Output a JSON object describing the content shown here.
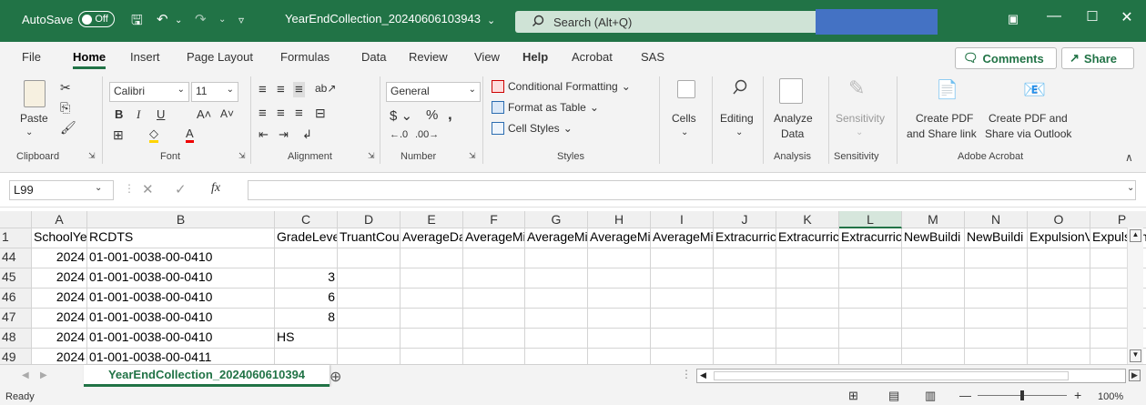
{
  "titlebar": {
    "autosave_label": "AutoSave",
    "autosave_state": "Off",
    "doc_title": "YearEndCollection_20240606103943",
    "search_placeholder": "Search (Alt+Q)"
  },
  "menu": {
    "items": [
      "File",
      "Home",
      "Insert",
      "Page Layout",
      "Formulas",
      "Data",
      "Review",
      "View",
      "Help",
      "Acrobat",
      "SAS"
    ],
    "active": "Home",
    "comments_label": "Comments",
    "share_label": "Share"
  },
  "ribbon": {
    "clipboard": {
      "paste": "Paste",
      "label": "Clipboard"
    },
    "font": {
      "name": "Calibri",
      "size": "11",
      "label": "Font"
    },
    "alignment": {
      "label": "Alignment"
    },
    "number": {
      "format": "General",
      "label": "Number"
    },
    "styles": {
      "conditional": "Conditional Formatting",
      "table": "Format as Table",
      "cell_styles": "Cell Styles",
      "label": "Styles"
    },
    "cells": {
      "label": "Cells"
    },
    "editing": {
      "label": "Editing"
    },
    "analysis": {
      "analyze": "Analyze",
      "analyze2": "Data",
      "label": "Analysis"
    },
    "sensitivity": {
      "button": "Sensitivity",
      "label": "Sensitivity"
    },
    "acrobat": {
      "create_pdf": "Create PDF",
      "create_pdf2": "and Share link",
      "share_outlook": "Create PDF and",
      "share_outlook2": "Share via Outlook",
      "label": "Adobe Acrobat"
    }
  },
  "formula_bar": {
    "name_box": "L99",
    "fx": "fx",
    "value": ""
  },
  "grid": {
    "columns": [
      "A",
      "B",
      "C",
      "D",
      "E",
      "F",
      "G",
      "H",
      "I",
      "J",
      "K",
      "L",
      "M",
      "N",
      "O",
      "P"
    ],
    "selected_column": "L",
    "rows": [
      {
        "num": "1",
        "cells": [
          "SchoolYea",
          "RCDTS",
          "GradeLeve",
          "TruantCou",
          "AverageDa",
          "AverageMi",
          "AverageMi",
          "AverageMi",
          "AverageMi",
          "Extracurric",
          "Extracurric",
          "Extracurric",
          "NewBuildi",
          "NewBuildi",
          "ExpulsionV",
          "Expulsion"
        ]
      },
      {
        "num": "44",
        "cells": [
          "2024",
          "01-001-0038-00-0410",
          "",
          "",
          "",
          "",
          "",
          "",
          "",
          "",
          "",
          "",
          "",
          "",
          "",
          ""
        ]
      },
      {
        "num": "45",
        "cells": [
          "2024",
          "01-001-0038-00-0410",
          "3",
          "",
          "",
          "",
          "",
          "",
          "",
          "",
          "",
          "",
          "",
          "",
          "",
          ""
        ]
      },
      {
        "num": "46",
        "cells": [
          "2024",
          "01-001-0038-00-0410",
          "6",
          "",
          "",
          "",
          "",
          "",
          "",
          "",
          "",
          "",
          "",
          "",
          "",
          ""
        ]
      },
      {
        "num": "47",
        "cells": [
          "2024",
          "01-001-0038-00-0410",
          "8",
          "",
          "",
          "",
          "",
          "",
          "",
          "",
          "",
          "",
          "",
          "",
          "",
          ""
        ]
      },
      {
        "num": "48",
        "cells": [
          "2024",
          "01-001-0038-00-0410",
          "HS",
          "",
          "",
          "",
          "",
          "",
          "",
          "",
          "",
          "",
          "",
          "",
          "",
          ""
        ]
      },
      {
        "num": "49",
        "cells": [
          "2024",
          "01-001-0038-00-0411",
          "",
          "",
          "",
          "",
          "",
          "",
          "",
          "",
          "",
          "",
          "",
          "",
          "",
          ""
        ]
      }
    ]
  },
  "sheet_tab": "YearEndCollection_2024060610394",
  "status": {
    "ready": "Ready",
    "zoom": "100%"
  },
  "colors": {
    "accent": "#217346",
    "title_bg": "#217346"
  }
}
